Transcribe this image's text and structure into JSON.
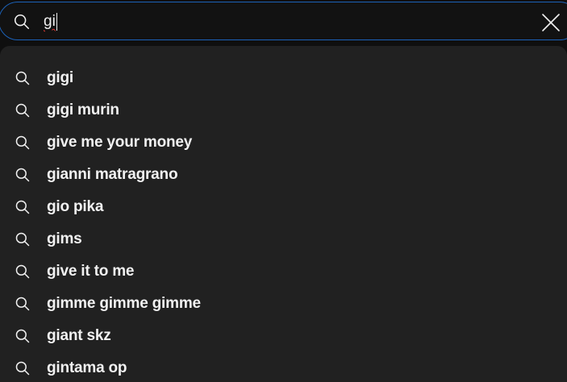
{
  "search": {
    "query": "gi",
    "icon": "search-icon",
    "clear_icon": "close-icon"
  },
  "suggestions": [
    {
      "label": "gigi"
    },
    {
      "label": "gigi murin"
    },
    {
      "label": "give me your money"
    },
    {
      "label": "gianni matragrano"
    },
    {
      "label": "gio pika"
    },
    {
      "label": "gims"
    },
    {
      "label": "give it to me"
    },
    {
      "label": "gimme gimme gimme"
    },
    {
      "label": "giant skz"
    },
    {
      "label": "gintama op"
    }
  ],
  "colors": {
    "page_bg": "#0f0f0f",
    "dropdown_bg": "#212121",
    "focus_border": "#1c62b9",
    "text": "#f1f1f1",
    "spellcheck": "#e53935"
  }
}
